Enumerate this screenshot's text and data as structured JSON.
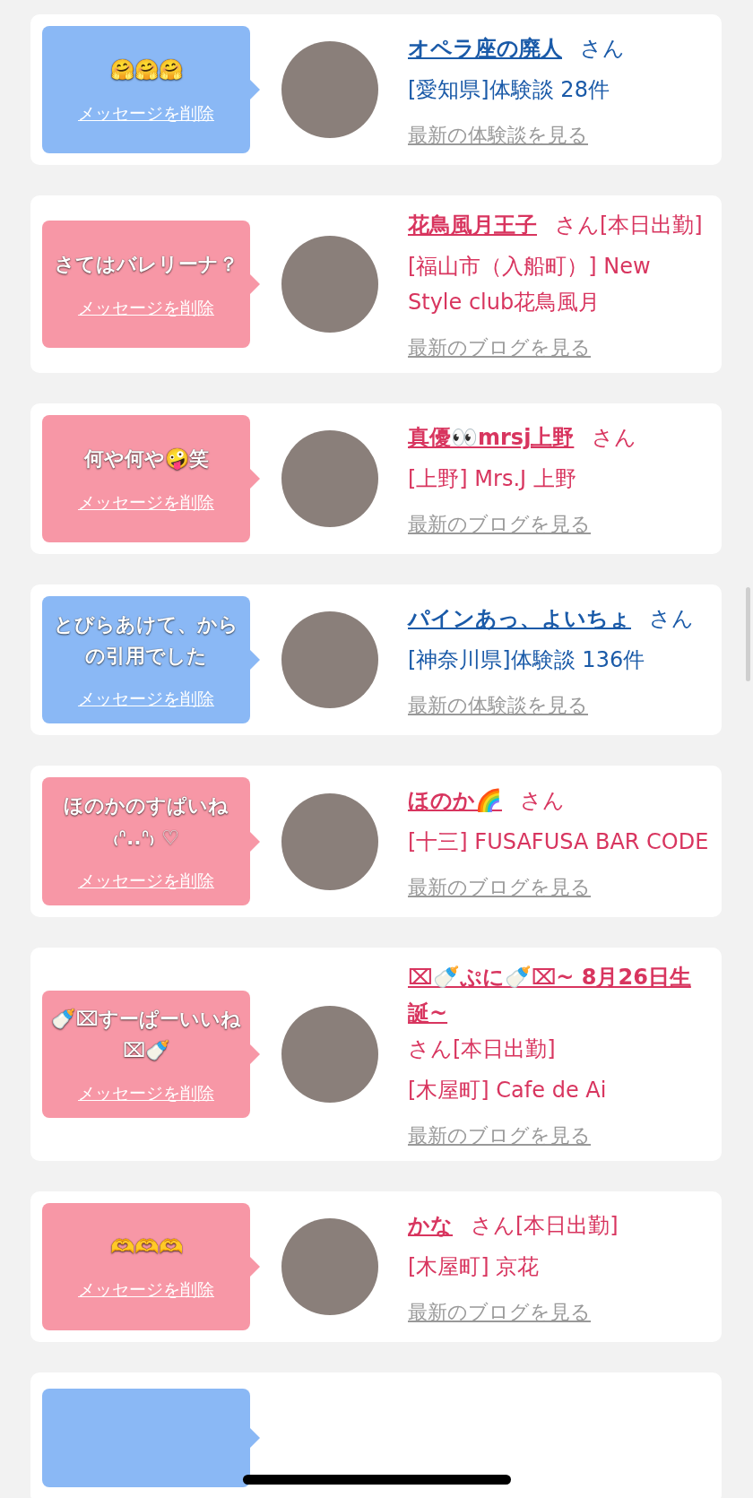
{
  "cards": [
    {
      "kind": "experience",
      "message": "🤗🤗🤗",
      "delete_link": "メッセージを削除",
      "name": "オペラ座の廃人",
      "suffix": "さん",
      "detail": "[愛知県]体験談 28件",
      "latest_link": "最新の体験談を見る"
    },
    {
      "kind": "blog",
      "message": "さてはバレリーナ？",
      "delete_link": "メッセージを削除",
      "name": "花鳥風月王子",
      "suffix": "さん[本日出勤]",
      "detail": "[福山市（入船町）] New Style club花鳥風月",
      "latest_link": "最新のブログを見る"
    },
    {
      "kind": "blog",
      "message": "何や何や🤪笑",
      "delete_link": "メッセージを削除",
      "name": "真優👀mrsj上野",
      "suffix": "さん",
      "detail": "[上野] Mrs.J 上野",
      "latest_link": "最新のブログを見る"
    },
    {
      "kind": "experience",
      "message": "とびらあけて、からの引用でした",
      "delete_link": "メッセージを削除",
      "name": "パインあっ、よいちょ",
      "suffix": "さん",
      "detail": "[神奈川県]体験談 136件",
      "latest_link": "最新の体験談を見る"
    },
    {
      "kind": "blog",
      "message": "ほのかのすぱいね ₍ᐢ..ᐢ₎ ♡",
      "delete_link": "メッセージを削除",
      "name": "ほのか🌈",
      "suffix": "さん",
      "detail": "[十三] FUSAFUSA BAR CODE",
      "latest_link": "最新のブログを見る"
    },
    {
      "kind": "blog",
      "message": "🍼⌧すーぱーいいね⌧🍼",
      "delete_link": "メッセージを削除",
      "name": "⌧🍼ぷに🍼⌧~ 8月26日生誕~",
      "suffix": "さん[本日出勤]",
      "detail": "[木屋町] Cafe de Ai",
      "latest_link": "最新のブログを見る"
    },
    {
      "kind": "blog",
      "message": "🫶🫶🫶",
      "delete_link": "メッセージを削除",
      "name": "かな",
      "suffix": "さん[本日出勤]",
      "detail": "[木屋町] 京花",
      "latest_link": "最新のブログを見る"
    }
  ],
  "partial_card": {
    "kind": "experience"
  }
}
